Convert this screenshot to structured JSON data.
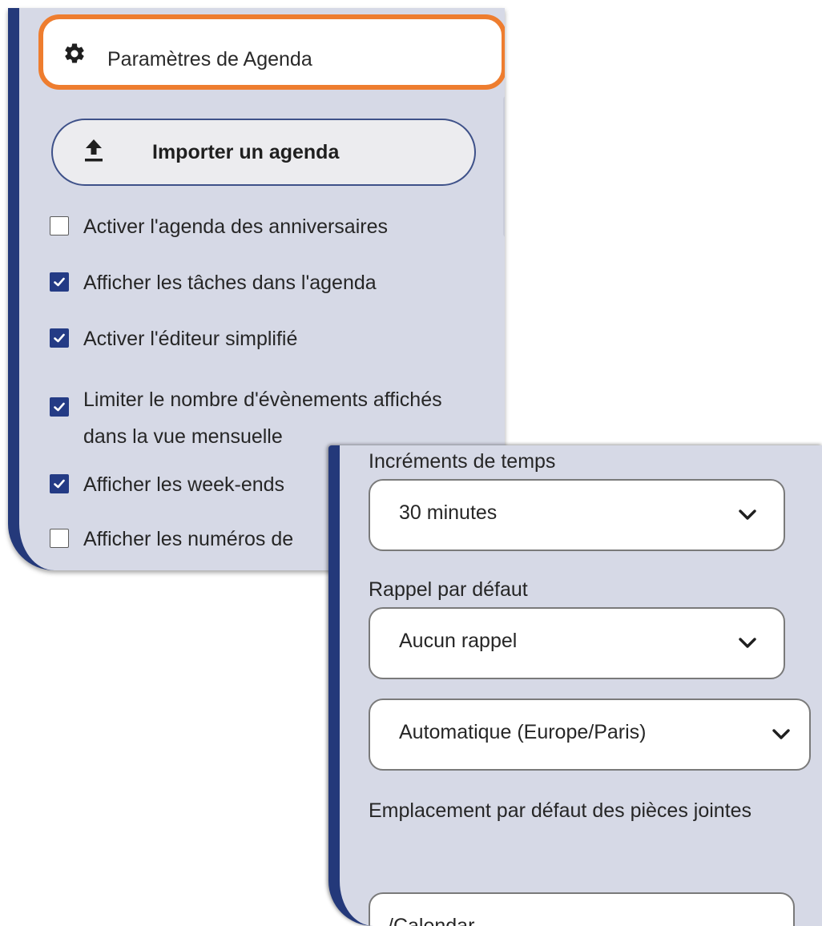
{
  "settings": {
    "title": "Paramètres de Agenda",
    "icon": "gear-icon",
    "highlight_color": "#ee7d2f"
  },
  "import_button": {
    "label": "Importer un agenda",
    "icon": "upload-icon"
  },
  "options": [
    {
      "label": "Activer l'agenda des anniversaires",
      "checked": false
    },
    {
      "label": "Afficher les tâches dans l'agenda",
      "checked": true
    },
    {
      "label": "Activer l'éditeur simplifié",
      "checked": true
    },
    {
      "label": "Limiter le nombre d'évènements affichés dans la vue mensuelle",
      "checked": true
    },
    {
      "label": "Afficher les week-ends",
      "checked": true
    },
    {
      "label": "Afficher les numéros de",
      "checked": false
    }
  ],
  "increments": {
    "label": "Incréments de temps",
    "value": "30 minutes"
  },
  "reminder": {
    "label": "Rappel par défaut",
    "value": "Aucun rappel"
  },
  "timezone": {
    "value": "Automatique (Europe/Paris)"
  },
  "attachments": {
    "label": "Emplacement par défaut des pièces jointes",
    "value": "/Calendar"
  },
  "colors": {
    "accent": "#24397a",
    "checkbox_checked": "#243b85",
    "panel_bg": "#d6d9e6"
  }
}
